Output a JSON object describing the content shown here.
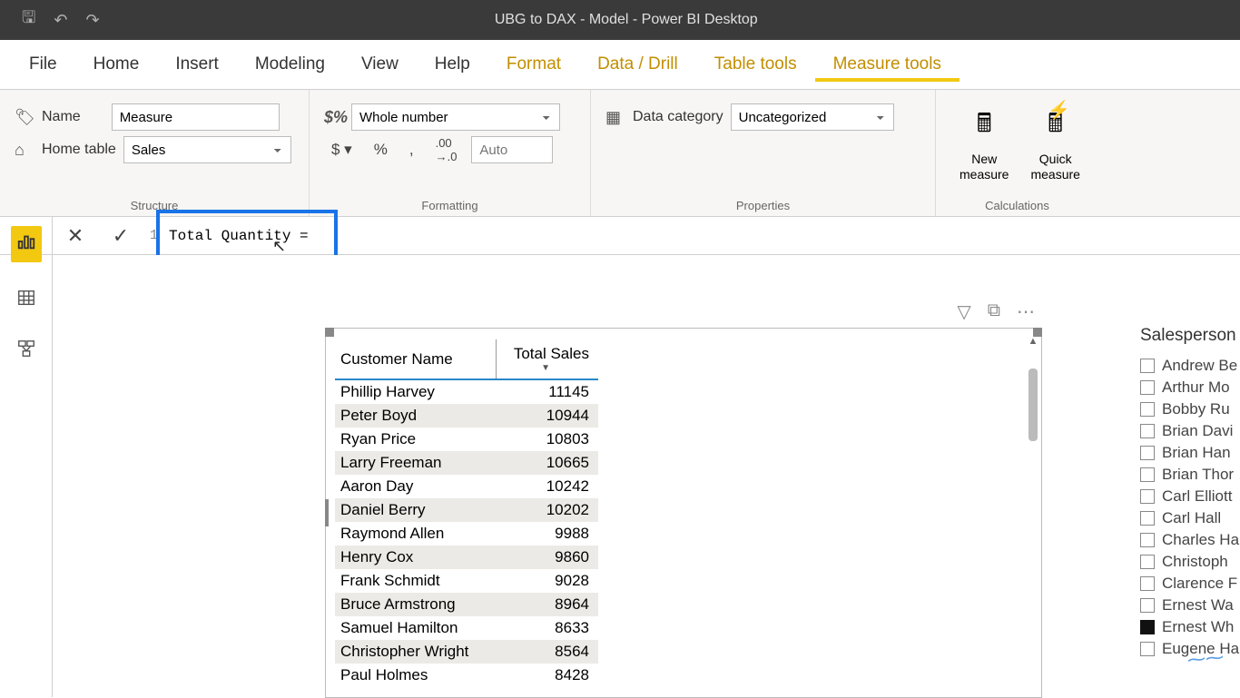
{
  "window_title": "UBG to DAX - Model - Power BI Desktop",
  "menu": {
    "file": "File",
    "home": "Home",
    "insert": "Insert",
    "modeling": "Modeling",
    "view": "View",
    "help": "Help",
    "format": "Format",
    "data_drill": "Data / Drill",
    "table_tools": "Table tools",
    "measure_tools": "Measure tools"
  },
  "ribbon": {
    "structure": {
      "label": "Structure",
      "name_label": "Name",
      "name_value": "Measure",
      "home_table_label": "Home table",
      "home_table_value": "Sales"
    },
    "formatting": {
      "label": "Formatting",
      "format_value": "Whole number",
      "auto_placeholder": "Auto"
    },
    "properties": {
      "label": "Properties",
      "data_category_label": "Data category",
      "data_category_value": "Uncategorized"
    },
    "calculations": {
      "label": "Calculations",
      "new_measure": "New\nmeasure",
      "quick_measure": "Quick\nmeasure"
    }
  },
  "formula_bar": {
    "line_number": "1",
    "content": "Total Quantity ="
  },
  "table_visual": {
    "columns": [
      "Customer Name",
      "Total Sales"
    ],
    "rows": [
      {
        "name": "Phillip Harvey",
        "value": "11145"
      },
      {
        "name": "Peter Boyd",
        "value": "10944"
      },
      {
        "name": "Ryan Price",
        "value": "10803"
      },
      {
        "name": "Larry Freeman",
        "value": "10665"
      },
      {
        "name": "Aaron Day",
        "value": "10242"
      },
      {
        "name": "Daniel Berry",
        "value": "10202"
      },
      {
        "name": "Raymond Allen",
        "value": "9988"
      },
      {
        "name": "Henry Cox",
        "value": "9860"
      },
      {
        "name": "Frank Schmidt",
        "value": "9028"
      },
      {
        "name": "Bruce Armstrong",
        "value": "8964"
      },
      {
        "name": "Samuel Hamilton",
        "value": "8633"
      },
      {
        "name": "Christopher Wright",
        "value": "8564"
      },
      {
        "name": "Paul Holmes",
        "value": "8428"
      }
    ]
  },
  "slicer": {
    "title": "Salesperson",
    "items": [
      {
        "label": "Andrew Be",
        "checked": false
      },
      {
        "label": "Arthur Mo",
        "checked": false
      },
      {
        "label": "Bobby Ru",
        "checked": false
      },
      {
        "label": "Brian Davi",
        "checked": false
      },
      {
        "label": "Brian Han",
        "checked": false
      },
      {
        "label": "Brian Thor",
        "checked": false
      },
      {
        "label": "Carl Elliott",
        "checked": false
      },
      {
        "label": "Carl Hall",
        "checked": false
      },
      {
        "label": "Charles Ha",
        "checked": false
      },
      {
        "label": "Christoph",
        "checked": false
      },
      {
        "label": "Clarence F",
        "checked": false
      },
      {
        "label": "Ernest Wa",
        "checked": false
      },
      {
        "label": "Ernest Wh",
        "checked": true
      },
      {
        "label": "Eugene Ha",
        "checked": false
      }
    ]
  }
}
